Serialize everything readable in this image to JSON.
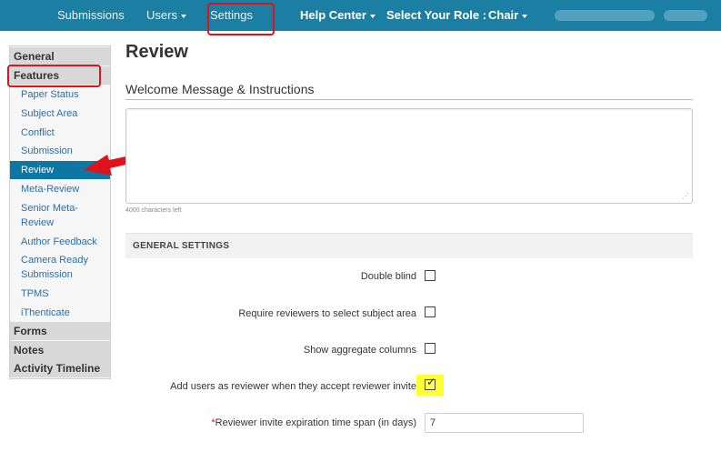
{
  "topnav": {
    "submissions": "Submissions",
    "users": "Users",
    "settings": "Settings",
    "help_center": "Help Center",
    "select_role_label": "Select Your Role :",
    "role": "Chair"
  },
  "sidebar": {
    "general": "General",
    "features": "Features",
    "items": [
      "Paper Status",
      "Subject Area",
      "Conflict",
      "Submission",
      "Review",
      "Meta-Review",
      "Senior Meta-Review",
      "Author Feedback",
      "Camera Ready Submission",
      "TPMS",
      "iThenticate"
    ],
    "active_item": "Review",
    "forms": "Forms",
    "notes": "Notes",
    "activity_timeline": "Activity Timeline"
  },
  "main": {
    "title": "Review",
    "welcome_section": "Welcome Message & Instructions",
    "textarea_value": "",
    "chars_left": "4000 characters left",
    "general_settings_header": "GENERAL SETTINGS",
    "settings": [
      {
        "label": "Double blind",
        "checked": false
      },
      {
        "label": "Require reviewers to select subject area",
        "checked": false
      },
      {
        "label": "Show aggregate columns",
        "checked": false
      },
      {
        "label": "Add users as reviewer when they accept reviewer invite",
        "checked": true
      }
    ],
    "expiration_required_mark": "*",
    "expiration_label": "Reviewer invite expiration time span (in days)",
    "expiration_value": "7"
  },
  "colors": {
    "topbar": "#1b7fa3",
    "active_item": "#0d77a3",
    "annotation_red": "#e0121b",
    "highlight_yellow": "#ffff33"
  }
}
